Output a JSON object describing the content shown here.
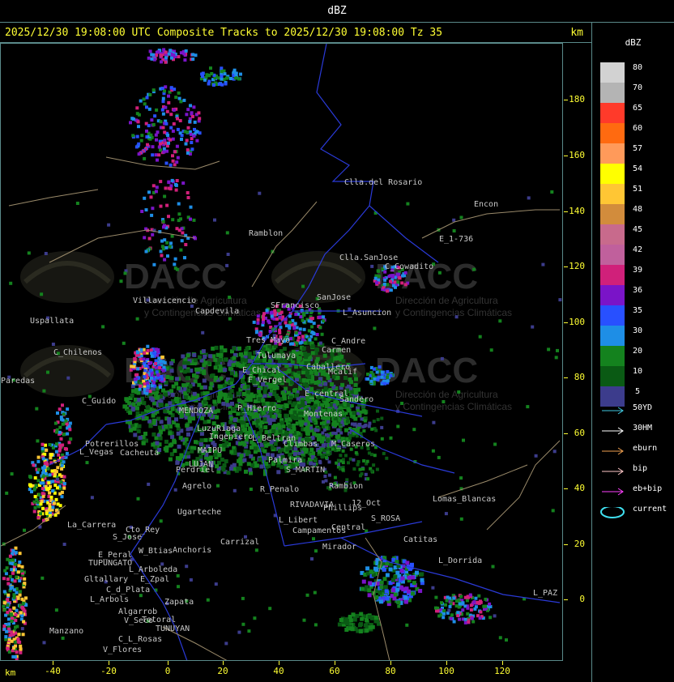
{
  "header": {
    "unit_label": "dBZ",
    "title": "2025/12/30 19:08:00 UTC Composite Tracks to 2025/12/30 19:08:00 Tz 35",
    "km_label": "km"
  },
  "axes": {
    "y_ticks": [
      "180",
      "160",
      "140",
      "120",
      "100",
      "80",
      "60",
      "40",
      "20",
      "0"
    ],
    "x_ticks": [
      "-40",
      "-20",
      "0",
      "20",
      "40",
      "60",
      "80",
      "100",
      "120"
    ],
    "x_unit": "km"
  },
  "legend": {
    "title": "dBZ",
    "levels": [
      {
        "value": "80",
        "color": "#d2d2d2"
      },
      {
        "value": "70",
        "color": "#b4b4b4"
      },
      {
        "value": "65",
        "color": "#ff3a2a"
      },
      {
        "value": "60",
        "color": "#ff6a10"
      },
      {
        "value": "57",
        "color": "#ff9a5a"
      },
      {
        "value": "54",
        "color": "#ffff00"
      },
      {
        "value": "51",
        "color": "#ffc634"
      },
      {
        "value": "48",
        "color": "#d28c3c"
      },
      {
        "value": "45",
        "color": "#c86a8c"
      },
      {
        "value": "42",
        "color": "#c0609c"
      },
      {
        "value": "39",
        "color": "#d0207a"
      },
      {
        "value": "36",
        "color": "#7a14c8"
      },
      {
        "value": "35",
        "color": "#2850ff"
      },
      {
        "value": "30",
        "color": "#1e8ee6"
      },
      {
        "value": "20",
        "color": "#14821e"
      },
      {
        "value": "10",
        "color": "#0a5a14"
      },
      {
        "value": "5",
        "color": "#3c3c8c"
      }
    ],
    "tracks": [
      {
        "label": "50YD",
        "color": "#40c8e0"
      },
      {
        "label": "30HM",
        "color": "#ffffff"
      },
      {
        "label": "eburn",
        "color": "#f0a050"
      },
      {
        "label": "bip",
        "color": "#ffc8c8"
      },
      {
        "label": "eb+bip",
        "color": "#ff40ff"
      },
      {
        "label": "current",
        "color": "#40e0f0"
      }
    ]
  },
  "map": {
    "watermark": "DACC",
    "watermark_sub1": "Dirección de Agricultura",
    "watermark_sub2": "y Contingencias Climáticas",
    "places": [
      {
        "name": "Clla.del Rosario"
      },
      {
        "name": "Encon"
      },
      {
        "name": "Ramblon"
      },
      {
        "name": "E_1-736"
      },
      {
        "name": "Clla.SanJose"
      },
      {
        "name": "C_Cowadito"
      },
      {
        "name": "Villavicencio"
      },
      {
        "name": "SanJose"
      },
      {
        "name": "Uspallata"
      },
      {
        "name": "Capdevila"
      },
      {
        "name": "SFrancisco"
      },
      {
        "name": "L_Asuncion"
      },
      {
        "name": "Tres_Mayo"
      },
      {
        "name": "C_Chilenos"
      },
      {
        "name": "Tulumaya"
      },
      {
        "name": "C_Andre"
      },
      {
        "name": "Carmen"
      },
      {
        "name": "E_Chical"
      },
      {
        "name": "Caballero"
      },
      {
        "name": "Mcalif"
      },
      {
        "name": "F_Vergel"
      },
      {
        "name": "Paredas"
      },
      {
        "name": "C_Guido"
      },
      {
        "name": "E_central"
      },
      {
        "name": "Sandero"
      },
      {
        "name": "P_Hierro"
      },
      {
        "name": "MENDOZA"
      },
      {
        "name": "Montenas"
      },
      {
        "name": "LuzuRiaga"
      },
      {
        "name": "Ingeniero"
      },
      {
        "name": "L_Beltran"
      },
      {
        "name": "MAIPU"
      },
      {
        "name": "Climbas"
      },
      {
        "name": "M_Caseros"
      },
      {
        "name": "Potrerillos"
      },
      {
        "name": "L_Vegas"
      },
      {
        "name": "Cacheuta"
      },
      {
        "name": "LUJAN"
      },
      {
        "name": "Palmira"
      },
      {
        "name": "S_MARTIN"
      },
      {
        "name": "Perdriel"
      },
      {
        "name": "Agrelo"
      },
      {
        "name": "R_Penalo"
      },
      {
        "name": "Rambion"
      },
      {
        "name": "Lomas_Blancas"
      },
      {
        "name": "Ugarteche"
      },
      {
        "name": "RIVADAVIA"
      },
      {
        "name": "12_Oct"
      },
      {
        "name": "Phillips"
      },
      {
        "name": "S_ROSA"
      },
      {
        "name": "L_Libert"
      },
      {
        "name": "La_Carrera"
      },
      {
        "name": "Cto_Rey"
      },
      {
        "name": "S_Jose"
      },
      {
        "name": "Campamentos"
      },
      {
        "name": "Central"
      },
      {
        "name": "Catitas"
      },
      {
        "name": "Carrizal"
      },
      {
        "name": "W_Btias"
      },
      {
        "name": "Anchoris"
      },
      {
        "name": "E_Peral"
      },
      {
        "name": "TUPUNGATO"
      },
      {
        "name": "Mirador"
      },
      {
        "name": "L_Dorrida"
      },
      {
        "name": "L_Arboleda"
      },
      {
        "name": "Gltallary"
      },
      {
        "name": "E_Zpal"
      },
      {
        "name": "C_d_Plata"
      },
      {
        "name": "L_Arbols"
      },
      {
        "name": "Zapata"
      },
      {
        "name": "L_PAZ"
      },
      {
        "name": "Algarrob"
      },
      {
        "name": "V_Seco"
      },
      {
        "name": "Totoral"
      },
      {
        "name": "TUNUYAN"
      },
      {
        "name": "Manzano"
      },
      {
        "name": "C_L_Rosas"
      },
      {
        "name": "V_Flores"
      }
    ]
  }
}
